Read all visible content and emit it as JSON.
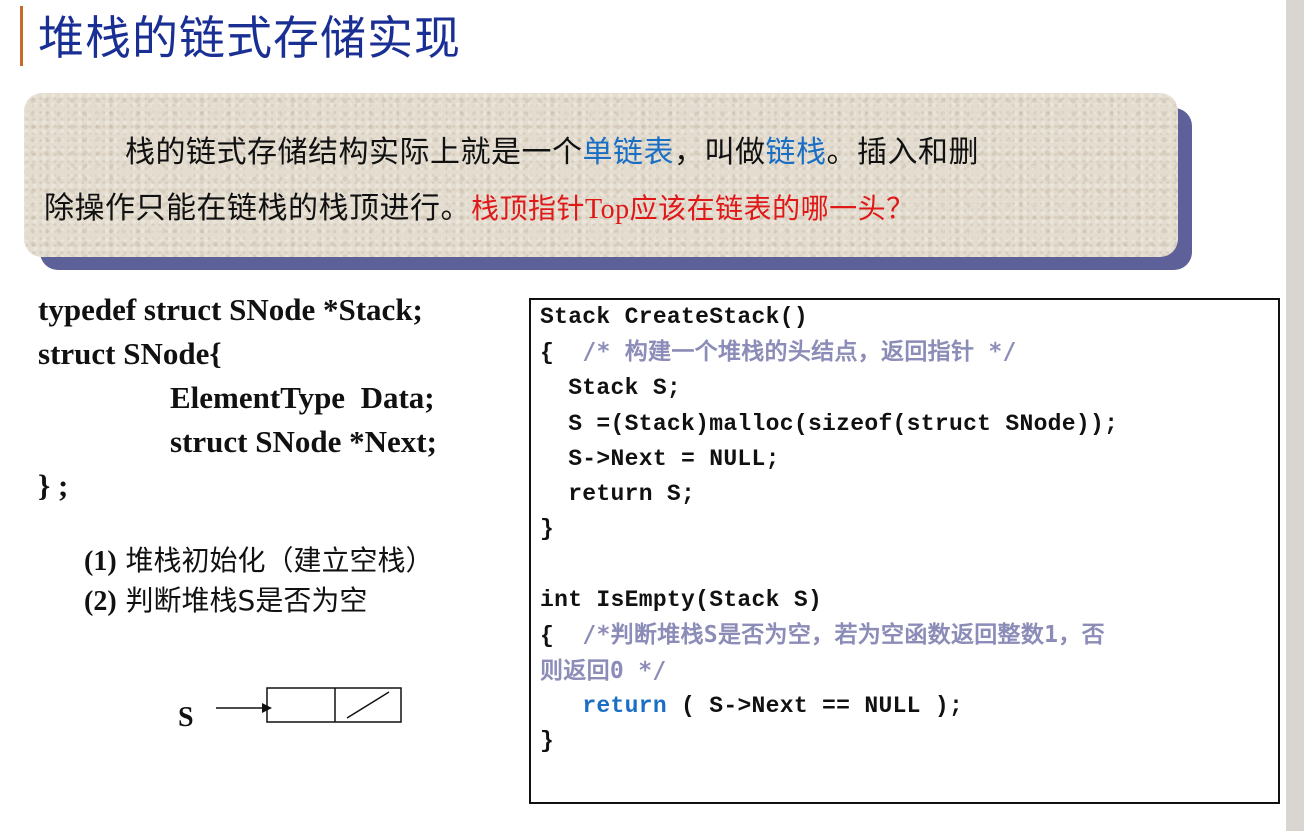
{
  "slide": {
    "title": "堆栈的链式存储实现"
  },
  "callout": {
    "line1": {
      "t1": "栈的链式存储结构实际上就是一个",
      "link1": "单链表",
      "t2": "，叫做",
      "link2": "链栈",
      "t3": "。插入和删"
    },
    "line2": {
      "t1": "除操作只能在链栈的栈顶进行。",
      "question": "栈顶指针Top应该在链表的哪一头？"
    }
  },
  "struct_def": {
    "line1": "typedef struct SNode *Stack;",
    "line2": "struct SNode{",
    "line3": "ElementType  Data;",
    "line4": "struct SNode *Next;",
    "line5": "} ;"
  },
  "operations": [
    {
      "num": "(1)",
      "text": " 堆栈初始化（建立空栈）"
    },
    {
      "num": "(2)",
      "text": " 判断堆栈S是否为空"
    }
  ],
  "diagram": {
    "label": "S"
  },
  "code": {
    "l1": "Stack CreateStack()",
    "l2_brace": "{  ",
    "l2_comment": "/* 构建一个堆栈的头结点，返回指针 */",
    "l3": "  Stack S;",
    "l4": "  S =(Stack)malloc(sizeof(struct SNode));",
    "l5": "  S->Next = NULL;",
    "l6": "  return S;",
    "l7": "}",
    "l8": "",
    "l9": "int IsEmpty(Stack S)",
    "l10_brace": "{  ",
    "l10_comment": "/*判断堆栈S是否为空，若为空函数返回整数1，否",
    "l11_comment": "则返回0 */",
    "l12_indent": "   ",
    "l12_kw": "return",
    "l12_rest": " ( S->Next == NULL );",
    "l13": "}"
  }
}
